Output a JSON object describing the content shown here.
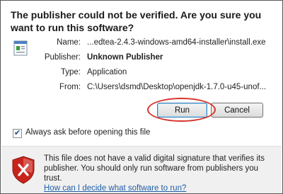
{
  "dialog": {
    "title": "The publisher could not be verified.  Are you sure you want to run this software?"
  },
  "details": [
    {
      "label": "Name:",
      "value": "...edtea-2.4.3-windows-amd64-installer\\install.exe",
      "bold": false
    },
    {
      "label": "Publisher:",
      "value": "Unknown Publisher",
      "bold": true
    },
    {
      "label": "Type:",
      "value": "Application",
      "bold": false
    },
    {
      "label": "From:",
      "value": "C:\\Users\\dsmd\\Desktop\\openjdk-1.7.0-u45-unof...",
      "bold": false
    }
  ],
  "buttons": {
    "run_label": "Run",
    "cancel_label": "Cancel"
  },
  "checkbox": {
    "label": "Always ask before opening this file",
    "checked": true,
    "glyph": "✔"
  },
  "warning": {
    "text": "This file does not have a valid digital signature that verifies its publisher.  You should only run software from publishers you trust.",
    "link": "How can I decide what software to run?"
  },
  "colors": {
    "highlight_ring": "#d9342b",
    "link": "#1f5fa6",
    "shield_red": "#c8241c"
  }
}
